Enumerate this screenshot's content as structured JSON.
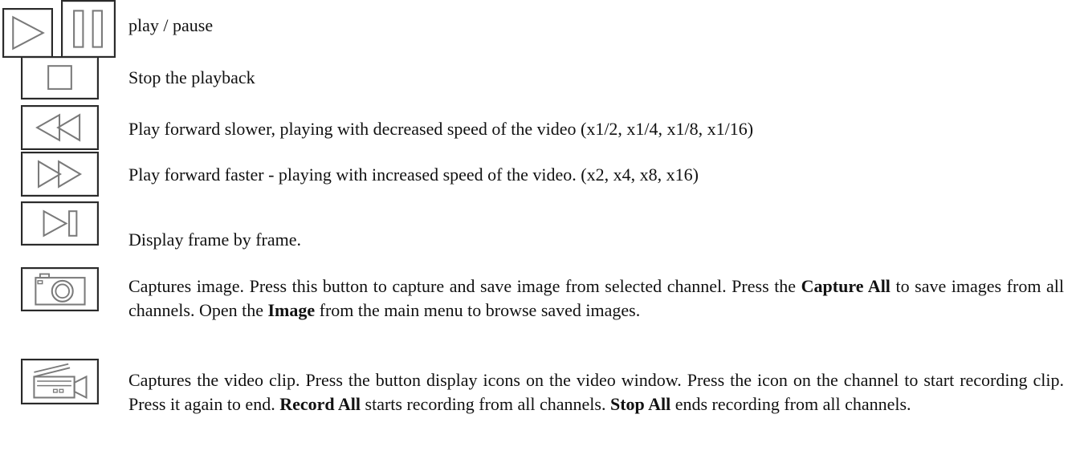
{
  "icons": {
    "play": "play-icon",
    "pause": "pause-icon",
    "stop": "stop-icon",
    "slow": "slow-forward-icon",
    "fast": "fast-forward-icon",
    "frame": "frame-step-icon",
    "capture": "camera-icon",
    "record": "video-camera-icon"
  },
  "rows": {
    "play_pause": "play / pause",
    "stop": "Stop the playback",
    "slow": "Play forward slower, playing with decreased speed of the video (x1/2, x1/4, x1/8, x1/16)",
    "fast": "Play forward faster - playing with increased speed of the video. (x2, x4, x8, x16)",
    "frame": "Display frame by frame.",
    "capture": {
      "t1": "Captures image. Press this button to capture and save image from selected channel. Press the ",
      "b1": "Capture All",
      "t2": " to save images from all channels. Open the ",
      "b2": "Image",
      "t3": " from the main menu to browse saved images."
    },
    "record": {
      "t1": "Captures the video clip. Press the button display icons on the video window. Press the icon on the channel to start recording clip. Press it again to end. ",
      "b1": "Record All",
      "t2": " starts recording from all channels. ",
      "b2": "Stop All",
      "t3": " ends recording from all channels."
    }
  }
}
